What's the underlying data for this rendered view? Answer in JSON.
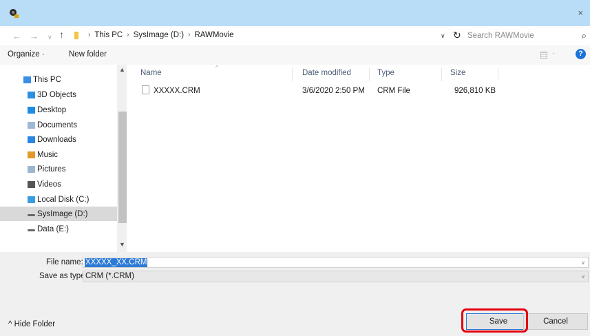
{
  "colors": {
    "title_bar": "#b9dcf7",
    "highlight_outline": "#e3000f",
    "selection": "#2c7bd6",
    "help": "#1a73d9"
  },
  "titlebar": {
    "app_icon": "camera-app-icon",
    "close_icon": "×"
  },
  "address": {
    "back_icon": "←",
    "forward_icon": "→",
    "recent_icon": "∨",
    "up_icon": "↑",
    "crumbs": [
      "This PC",
      "SysImage (D:)",
      "RAWMovie"
    ],
    "separator": "›",
    "dropdown_icon": "∨",
    "refresh_icon": "↻",
    "search_placeholder": "Search RAWMovie",
    "search_icon": "⌕"
  },
  "toolbar": {
    "organize": "Organize ·",
    "new_folder": "New folder",
    "view_dropdown": "·",
    "help": "?"
  },
  "navigation": {
    "items": [
      {
        "label": "This PC",
        "icon": "pc-icon",
        "color": "#3a8ee6"
      },
      {
        "label": "3D Objects",
        "icon": "3d-objects-icon",
        "color": "#2b8fe0"
      },
      {
        "label": "Desktop",
        "icon": "desktop-icon",
        "color": "#1f8be3"
      },
      {
        "label": "Documents",
        "icon": "documents-icon",
        "color": "#9fb8d6"
      },
      {
        "label": "Downloads",
        "icon": "downloads-icon",
        "color": "#2a86e0"
      },
      {
        "label": "Music",
        "icon": "music-icon",
        "color": "#e09a2a"
      },
      {
        "label": "Pictures",
        "icon": "pictures-icon",
        "color": "#9bb7cf"
      },
      {
        "label": "Videos",
        "icon": "videos-icon",
        "color": "#555555"
      },
      {
        "label": "Local Disk (C:)",
        "icon": "local-disk-icon",
        "color": "#3b9de0"
      },
      {
        "label": "SysImage (D:)",
        "icon": "drive-icon",
        "color": "#666666",
        "selected": true
      },
      {
        "label": "Data (E:)",
        "icon": "drive-icon",
        "color": "#666666"
      }
    ]
  },
  "file_list": {
    "columns": [
      "Name",
      "Date modified",
      "Type",
      "Size"
    ],
    "sort_indicator": "^",
    "rows": [
      {
        "name": "XXXXX.CRM",
        "date": "3/6/2020 2:50 PM",
        "type": "CRM File",
        "size": "926,810 KB"
      }
    ]
  },
  "save_area": {
    "file_name_label": "File name:",
    "file_name_value": "XXXXX_XX.CRM",
    "save_type_label": "Save as type:",
    "save_type_value": "CRM (*.CRM)",
    "dropdown_icon": "∨",
    "hide_folder": "^ Hide Folder",
    "save_button": "Save",
    "cancel_button": "Cancel"
  }
}
